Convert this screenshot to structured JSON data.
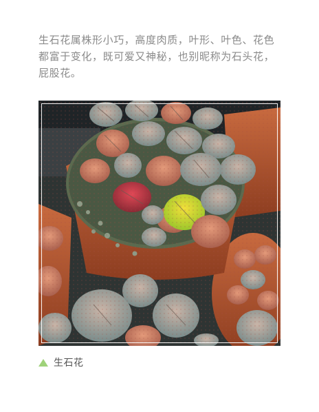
{
  "article": {
    "intro_text": "生石花属株形小巧，高度肉质，叶形、叶色、花色都富于变化，既可爱又神秘，也别昵称为石头花，屁股花。",
    "image": {
      "subject": "生石花",
      "accent_color": "#9fd27a"
    },
    "caption": {
      "icon": "triangle-up-icon",
      "text": "生石花"
    }
  }
}
